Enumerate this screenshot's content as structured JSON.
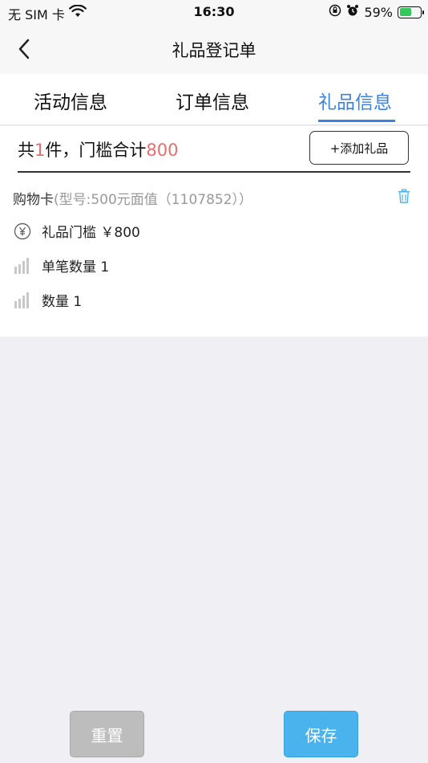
{
  "status_bar": {
    "carrier": "无 SIM 卡",
    "time": "16:30",
    "battery": "59%",
    "battery_level": 0.59,
    "battery_color": "#34c759"
  },
  "nav": {
    "title": "礼品登记单",
    "back_icon": "chevron-left-icon"
  },
  "tabs": [
    {
      "label": "活动信息",
      "active": false
    },
    {
      "label": "订单信息",
      "active": false
    },
    {
      "label": "礼品信息",
      "active": true
    }
  ],
  "accent_color": "#3a82e0",
  "summary": {
    "prefix": "共",
    "count": "1",
    "middle": "件，门槛合计",
    "total": "800",
    "highlight_color": "#e96d6d"
  },
  "add_gift_label": "+添加礼品",
  "gift": {
    "name": "购物卡",
    "model": "(型号:500元面值（1107852））",
    "threshold": "礼品门槛  ￥800",
    "single_qty": "单笔数量 1",
    "qty": "数量 1"
  },
  "buttons": {
    "reset": "重置",
    "save": "保存"
  }
}
